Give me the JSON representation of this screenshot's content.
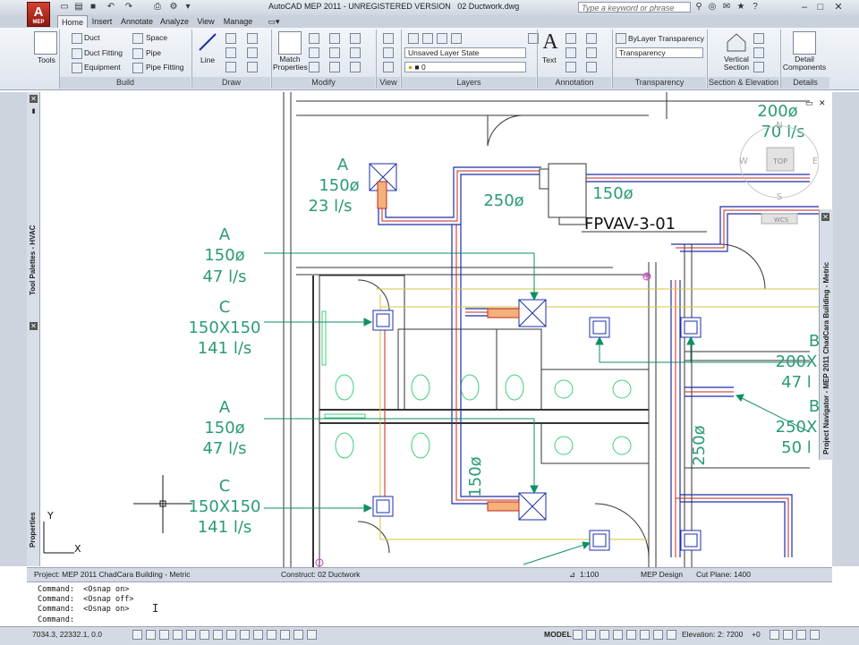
{
  "window": {
    "title": "AutoCAD MEP 2011 - UNREGISTERED VERSION",
    "document": "02 Ductwork.dwg",
    "search_placeholder": "Type a keyword or phrase",
    "logo_text": "A",
    "logo_sub": "MEP"
  },
  "tabs": [
    "Home",
    "Insert",
    "Annotate",
    "Analyze",
    "View",
    "Manage"
  ],
  "ribbon": {
    "tools_label": "Tools",
    "build": {
      "title": "Build",
      "duct": "Duct",
      "duct_fitting": "Duct Fitting",
      "equipment": "Equipment",
      "space": "Space",
      "pipe": "Pipe",
      "pipe_fitting": "Pipe Fitting"
    },
    "draw": {
      "title": "Draw",
      "line": "Line"
    },
    "modify": {
      "title": "Modify",
      "match_properties": "Match Properties"
    },
    "view": {
      "title": "View"
    },
    "layers": {
      "title": "Layers",
      "layer_state": "Unsaved Layer State",
      "current_layer": "0"
    },
    "annotation": {
      "title": "Annotation",
      "text": "Text"
    },
    "transparency": {
      "title": "Transparency",
      "bylayer": "ByLayer Transparency",
      "field": "Transparency"
    },
    "section": {
      "title": "Section & Elevation",
      "vertical_section": "Vertical Section"
    },
    "details": {
      "title": "Details",
      "detail_components": "Detail Components"
    }
  },
  "palettes": {
    "tool_palettes": "Tool Palettes - HVAC",
    "properties": "Properties",
    "project_navigator": "Project Navigator - MEP 2011 ChadCara Building - Metric"
  },
  "viewcube": {
    "top": "TOP",
    "n": "N",
    "w": "W",
    "e": "E",
    "s": "S",
    "wcs": "WCS"
  },
  "drawing": {
    "labels": [
      {
        "lines": [
          "A",
          "150ø",
          "23 l/s"
        ]
      },
      {
        "lines": [
          "A",
          "150ø",
          "47 l/s"
        ]
      },
      {
        "lines": [
          "C",
          "150X150",
          "141 l/s"
        ]
      },
      {
        "lines": [
          "A",
          "150ø",
          "47 l/s"
        ]
      },
      {
        "lines": [
          "C",
          "150X150",
          "141 l/s"
        ]
      },
      {
        "lines": [
          "200ø",
          "70 l/s"
        ]
      },
      {
        "lines": [
          "B",
          "200X",
          "47 l"
        ]
      },
      {
        "lines": [
          "B",
          "250X",
          "50 l"
        ]
      }
    ],
    "duct_sizes": [
      "250ø",
      "150ø",
      "150ø",
      "250ø"
    ],
    "equipment_tag": "FPVAV-3-01",
    "ucs": {
      "x": "X",
      "y": "Y"
    }
  },
  "layout_bar": {
    "project": "Project: MEP 2011 ChadCara Building - Metric",
    "construct": "Construct: 02 Ductwork",
    "scale": "1:100",
    "display": "MEP Design",
    "cut_plane": "Cut Plane: 1400"
  },
  "command_lines": [
    "Command:  <Osnap on>",
    "Command:  <Osnap off>",
    "Command:  <Osnap on>",
    "Command:"
  ],
  "status_bar": {
    "coords": "7034.3, 22332.1, 0.0",
    "model": "MODEL",
    "elevation": "Elevation:",
    "elevation_value": "2: 7200",
    "offset": "+0"
  },
  "colors": {
    "duct_blue": "#1b2fa8",
    "duct_red": "#c8241b",
    "annotation": "#2a9b74",
    "leader": "#0f8f66"
  }
}
